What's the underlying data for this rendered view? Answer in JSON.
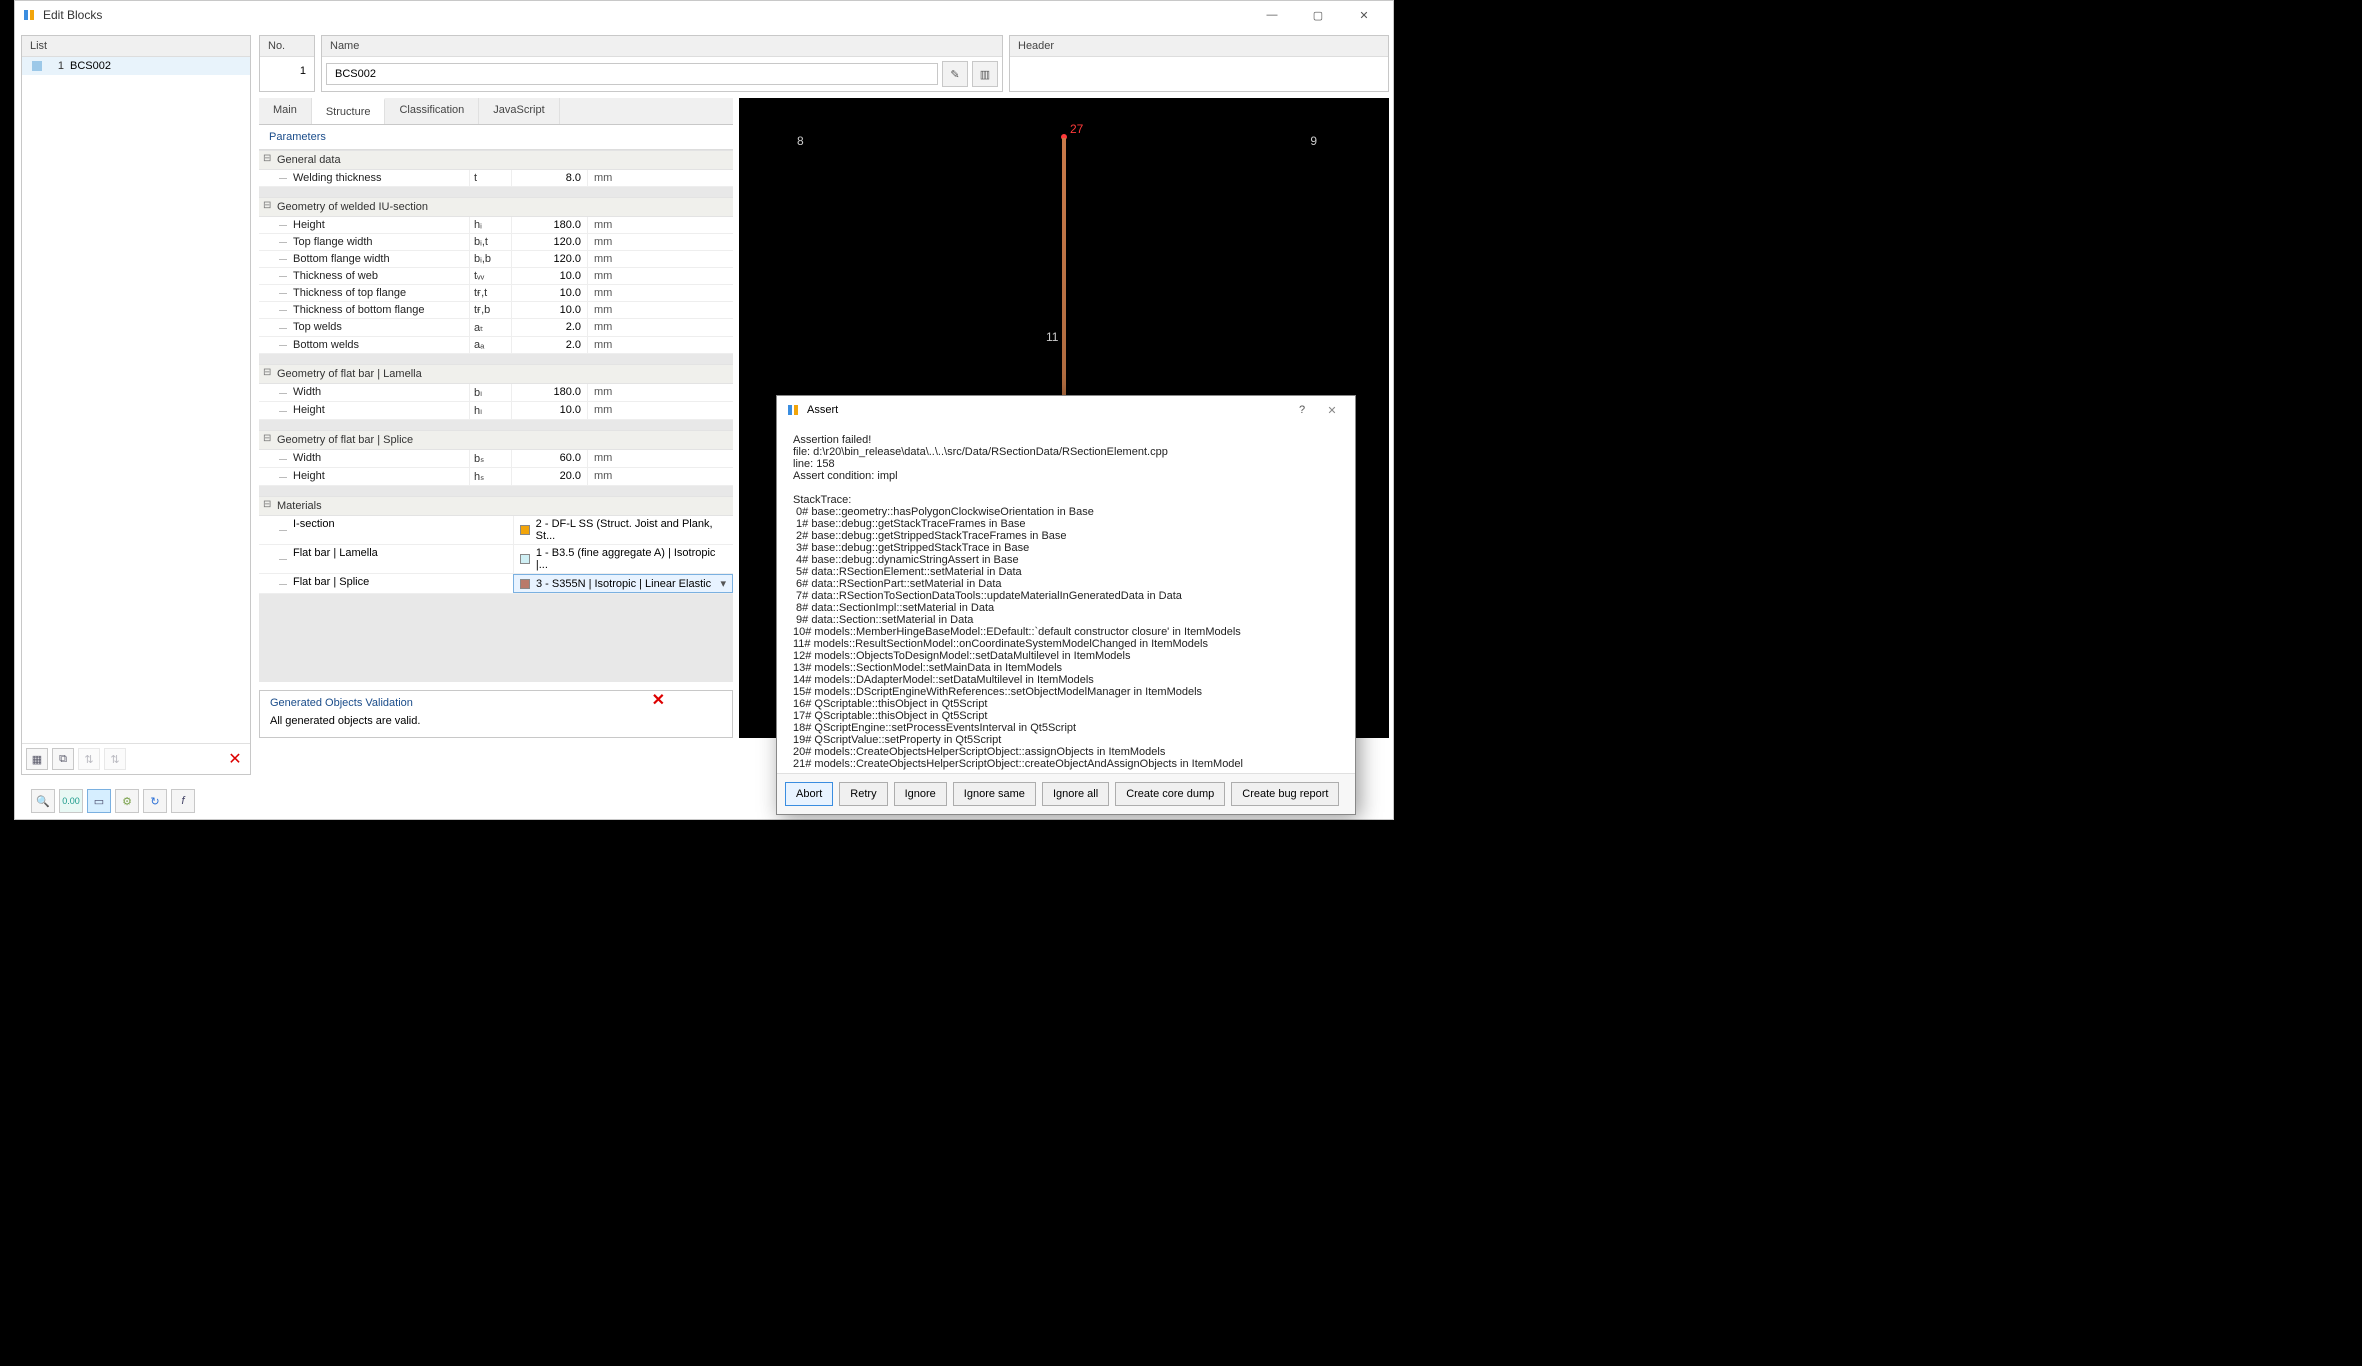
{
  "window": {
    "title": "Edit Blocks"
  },
  "sidebar": {
    "header": "List",
    "items": [
      {
        "num": "1",
        "name": "BCS002"
      }
    ]
  },
  "no": {
    "header": "No.",
    "value": "1"
  },
  "name": {
    "header": "Name",
    "value": "BCS002"
  },
  "headerPanel": {
    "header": "Header"
  },
  "tabs": [
    "Main",
    "Structure",
    "Classification",
    "JavaScript"
  ],
  "activeTab": "Structure",
  "parametersTitle": "Parameters",
  "groups": {
    "general": {
      "title": "General data",
      "rows": [
        {
          "name": "Welding thickness",
          "sym": "t",
          "val": "8.0",
          "unit": "mm"
        }
      ]
    },
    "iu": {
      "title": "Geometry of welded IU-section",
      "rows": [
        {
          "name": "Height",
          "sym": "hᵢ",
          "val": "180.0",
          "unit": "mm"
        },
        {
          "name": "Top flange width",
          "sym": "bᵢ,t",
          "val": "120.0",
          "unit": "mm"
        },
        {
          "name": "Bottom flange width",
          "sym": "bᵢ,b",
          "val": "120.0",
          "unit": "mm"
        },
        {
          "name": "Thickness of web",
          "sym": "tᵥᵥ",
          "val": "10.0",
          "unit": "mm"
        },
        {
          "name": "Thickness of top flange",
          "sym": "tғ,t",
          "val": "10.0",
          "unit": "mm"
        },
        {
          "name": "Thickness of bottom flange",
          "sym": "tғ,b",
          "val": "10.0",
          "unit": "mm"
        },
        {
          "name": "Top welds",
          "sym": "aₜ",
          "val": "2.0",
          "unit": "mm"
        },
        {
          "name": "Bottom welds",
          "sym": "aₐ",
          "val": "2.0",
          "unit": "mm"
        }
      ]
    },
    "lamella": {
      "title": "Geometry of flat bar | Lamella",
      "rows": [
        {
          "name": "Width",
          "sym": "bₗ",
          "val": "180.0",
          "unit": "mm"
        },
        {
          "name": "Height",
          "sym": "hₗ",
          "val": "10.0",
          "unit": "mm"
        }
      ]
    },
    "splice": {
      "title": "Geometry of flat bar | Splice",
      "rows": [
        {
          "name": "Width",
          "sym": "bₛ",
          "val": "60.0",
          "unit": "mm"
        },
        {
          "name": "Height",
          "sym": "hₛ",
          "val": "20.0",
          "unit": "mm"
        }
      ]
    },
    "materials": {
      "title": "Materials",
      "rows": [
        {
          "label": "I-section",
          "color": "#f2a50a",
          "value": "2 - DF-L SS (Struct. Joist and Plank, St..."
        },
        {
          "label": "Flat bar | Lamella",
          "color": "#cfeff4",
          "value": "1 - B3.5 (fine aggregate A) | Isotropic |..."
        },
        {
          "label": "Flat bar | Splice",
          "color": "#b97a6a",
          "value": "3 - S355N | Isotropic | Linear Elastic",
          "selected": true
        }
      ]
    }
  },
  "validation": {
    "title": "Generated Objects Validation",
    "message": "All generated objects are valid."
  },
  "preview": {
    "labels": {
      "topLeft": "8",
      "topRight": "9",
      "topCenter": "27",
      "mid": "11"
    }
  },
  "assert": {
    "title": "Assert",
    "lines": {
      "l0": "Assertion failed!",
      "l1": "file: d:\\r20\\bin_release\\data\\..\\..\\src/Data/RSectionData/RSectionElement.cpp",
      "l2": "line: 158",
      "l3": "Assert condition: impl",
      "l4": "",
      "l5": "StackTrace:",
      "l6": " 0# base::geometry::hasPolygonClockwiseOrientation in Base",
      "l7": " 1# base::debug::getStackTraceFrames in Base",
      "l8": " 2# base::debug::getStrippedStackTraceFrames in Base",
      "l9": " 3# base::debug::getStrippedStackTrace in Base",
      "l10": " 4# base::debug::dynamicStringAssert in Base",
      "l11": " 5# data::RSectionElement::setMaterial in Data",
      "l12": " 6# data::RSectionPart::setMaterial in Data",
      "l13": " 7# data::RSectionToSectionDataTools::updateMaterialInGeneratedData in Data",
      "l14": " 8# data::SectionImpl::setMaterial in Data",
      "l15": " 9# data::Section::setMaterial in Data",
      "l16": "10# models::MemberHingeBaseModel::EDefault::`default constructor closure' in ItemModels",
      "l17": "11# models::ResultSectionModel::onCoordinateSystemModelChanged in ItemModels",
      "l18": "12# models::ObjectsToDesignModel::setDataMultilevel in ItemModels",
      "l19": "13# models::SectionModel::setMainData in ItemModels",
      "l20": "14# models::DAdapterModel::setDataMultilevel in ItemModels",
      "l21": "15# models::DScriptEngineWithReferences::setObjectModelManager in ItemModels",
      "l22": "16# QScriptable::thisObject in Qt5Script",
      "l23": "17# QScriptable::thisObject in Qt5Script",
      "l24": "18# QScriptEngine::setProcessEventsInterval in Qt5Script",
      "l25": "19# QScriptValue::setProperty in Qt5Script",
      "l26": "20# models::CreateObjectsHelperScriptObject::assignObjects in ItemModels",
      "l27": "21# models::CreateObjectsHelperScriptObject::createObjectAndAssignObjects in ItemModel"
    },
    "buttons": [
      "Abort",
      "Retry",
      "Ignore",
      "Ignore same",
      "Ignore all",
      "Create core dump",
      "Create bug report"
    ]
  }
}
